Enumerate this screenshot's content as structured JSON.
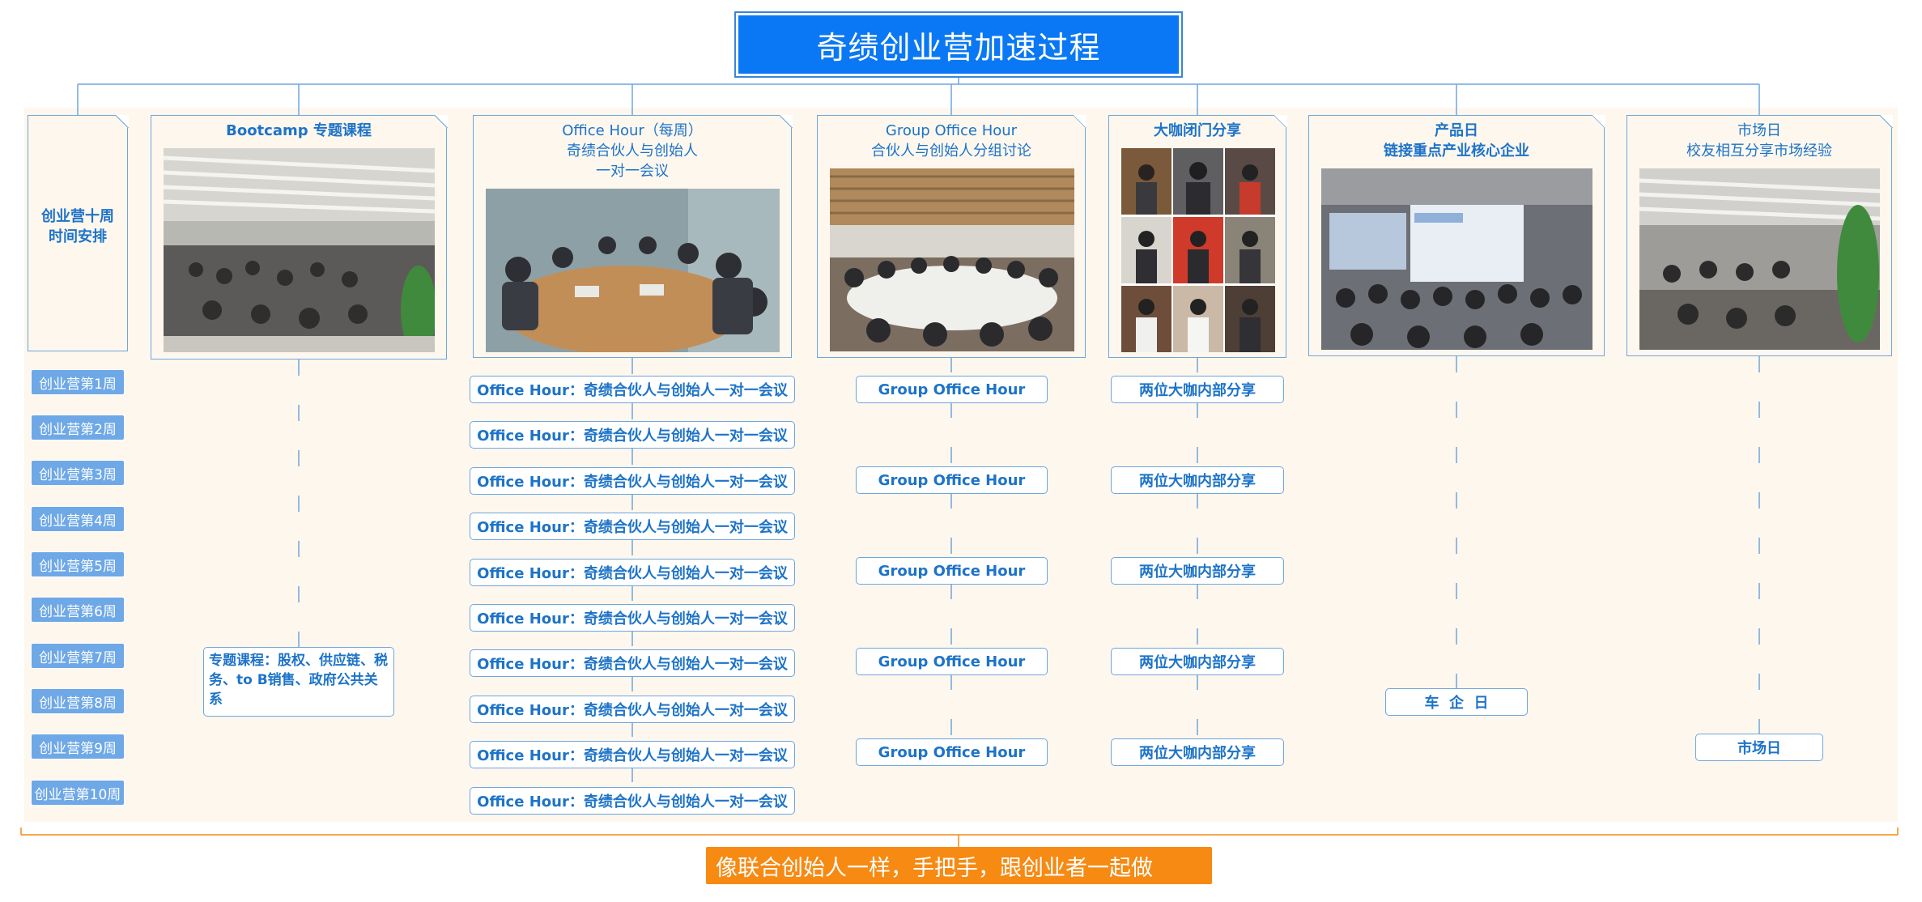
{
  "title": "奇绩创业营加速过程",
  "weeks": {
    "title_line1": "创业营十周",
    "title_line2": "时间安排",
    "items": [
      "创业营第1周",
      "创业营第2周",
      "创业营第3周",
      "创业营第4周",
      "创业营第5周",
      "创业营第6周",
      "创业营第7周",
      "创业营第8周",
      "创业营第9周",
      "创业营第10周"
    ]
  },
  "bootcamp": {
    "title": "Bootcamp 专题课程",
    "note": "专题课程：股权、供应链、税务、to B销售、政府公共关系"
  },
  "office_hour": {
    "title_line1": "Office Hour（每周）",
    "title_line2": "奇绩合伙人与创始人",
    "title_line3": "一对一会议",
    "item": "Office Hour：奇绩合伙人与创始人一对一会议",
    "count": 10
  },
  "group_office_hour": {
    "title_line1": "Group Office Hour",
    "title_line2": "合伙人与创始人分组讨论",
    "item": "Group Office Hour",
    "count": 5
  },
  "talks": {
    "title": "大咖闭门分享",
    "item": "两位大咖内部分享",
    "count": 5
  },
  "product_day": {
    "title_line1": "产品日",
    "title_line2": "链接重点产业核心企业",
    "item": "车  企  日"
  },
  "market_day": {
    "title_line1": "市场日",
    "title_line2": "校友相互分享市场经验",
    "item": "市场日"
  },
  "slogan": "像联合创始人一样，手把手，跟创业者一起做",
  "colors": {
    "title_bg": "#0a78f4",
    "line_blue": "#6fa6dc",
    "text_blue": "#1d73c9",
    "week_badge": "#6ea8e6",
    "band_bg": "#fdf7ee",
    "slogan_bg": "#f68a13"
  }
}
